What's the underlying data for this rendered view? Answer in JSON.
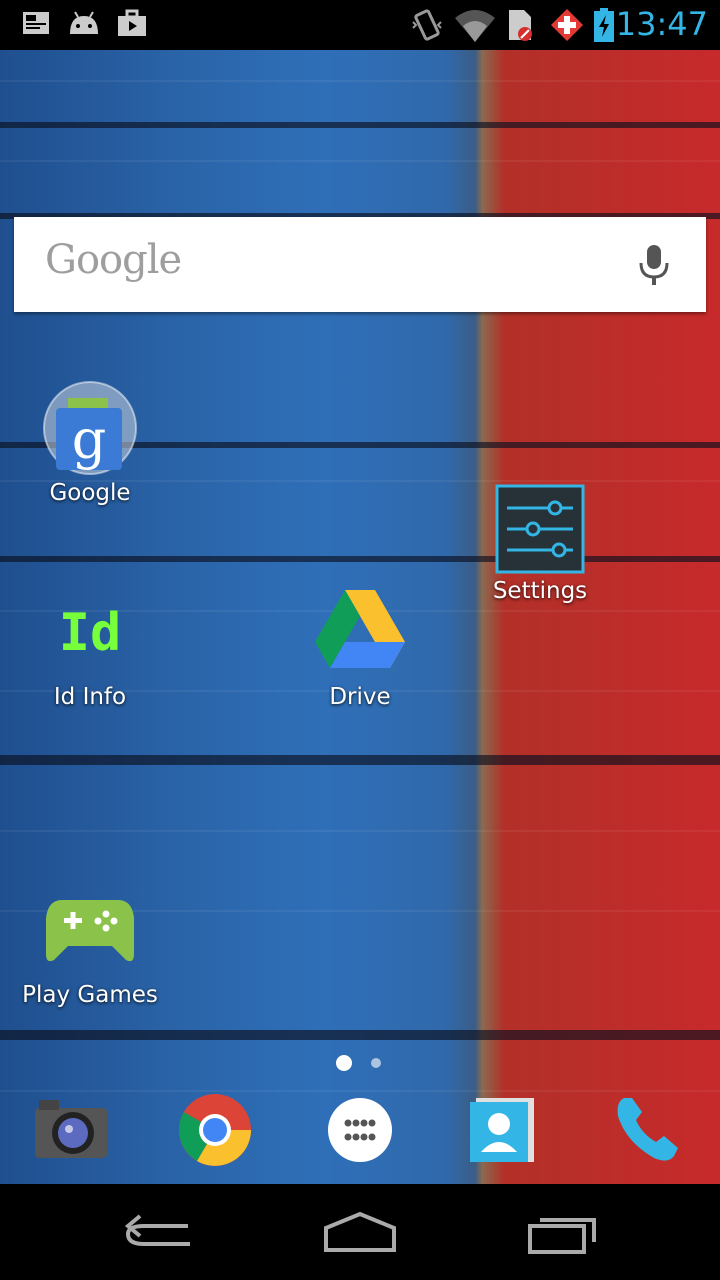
{
  "status_bar": {
    "time": "13:47",
    "notification_icons": [
      "screenshot-icon",
      "android-debug-icon",
      "briefcase-icon"
    ],
    "system_icons": [
      "vibrate-icon",
      "wifi-icon",
      "sim-icon",
      "red-cross-icon",
      "battery-charging-icon"
    ]
  },
  "search": {
    "logo_text": "Google",
    "mic_icon": "mic-icon"
  },
  "apps": [
    {
      "label": "Google",
      "icon": "google-folder-icon"
    },
    {
      "label": "Settings",
      "icon": "settings-icon"
    },
    {
      "label": "Id Info",
      "icon": "id-info-icon"
    },
    {
      "label": "Drive",
      "icon": "drive-icon"
    },
    {
      "label": "Play Games",
      "icon": "play-games-icon"
    }
  ],
  "page_indicator": {
    "pages": 2,
    "current": 1
  },
  "dock": [
    "camera-icon",
    "chrome-icon",
    "app-drawer-icon",
    "contacts-icon",
    "phone-icon"
  ],
  "nav": [
    "back-icon",
    "home-icon",
    "recents-icon"
  ],
  "colors": {
    "clock": "#33b5e5",
    "search_bg": "#ffffff"
  }
}
